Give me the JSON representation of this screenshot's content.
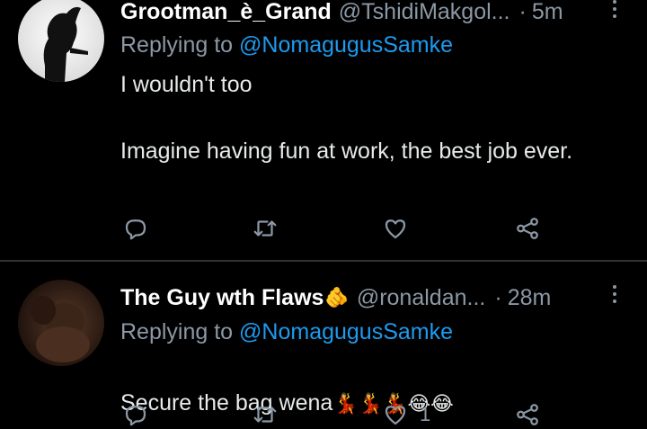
{
  "tweets": [
    {
      "display_name": "Grootman_è_Grand",
      "handle": "@TshidiMakgol...",
      "separator": "·",
      "time": "5m",
      "replying_prefix": "Replying to ",
      "replying_to": "@NomagugusSamke",
      "text": "I wouldn't too\n\nImagine having fun at work, the best job ever.",
      "counts": {
        "reply": "",
        "retweet": "",
        "like": "",
        "share": ""
      }
    },
    {
      "display_name": "The Guy wth Flaws",
      "name_emoji": "🫵",
      "handle": "@ronaldan...",
      "separator": "·",
      "time": "28m",
      "replying_prefix": "Replying to ",
      "replying_to": "@NomagugusSamke",
      "text": "Secure the bag wena",
      "text_emoji": "💃💃💃😂😂",
      "counts": {
        "reply": "",
        "retweet": "",
        "like": "1",
        "share": ""
      }
    }
  ],
  "colors": {
    "background": "#000000",
    "text": "#e7e9ea",
    "secondary": "#8b98a5",
    "link": "#1d9bf0",
    "divider": "#2f3336"
  },
  "icons": [
    "reply-icon",
    "retweet-icon",
    "like-icon",
    "share-icon",
    "more-icon"
  ]
}
